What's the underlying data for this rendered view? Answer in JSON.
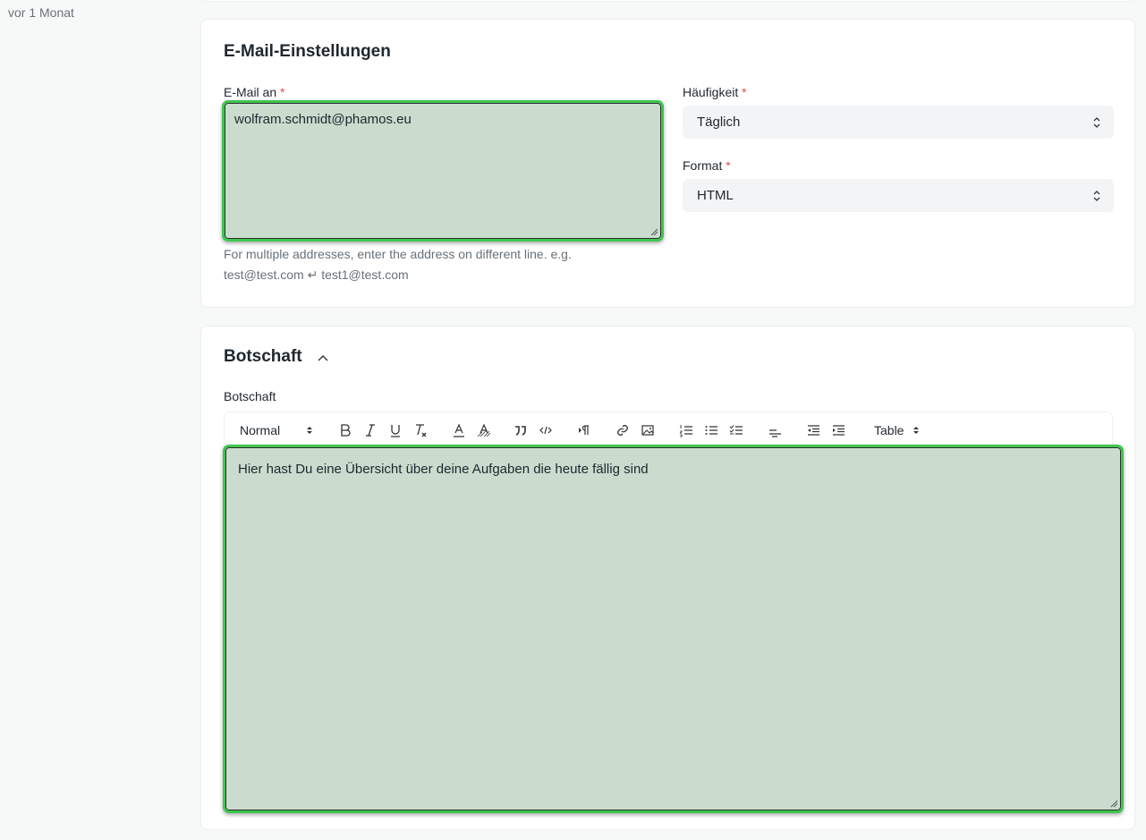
{
  "sidebar": {
    "timestamp": "vor 1 Monat"
  },
  "email_settings": {
    "title": "E-Mail-Einstellungen",
    "email_to": {
      "label": "E-Mail an",
      "required_mark": "*",
      "value": "wolfram.schmidt@phamos.eu",
      "help_line1": "For multiple addresses, enter the address on different line. e.g.",
      "help_line2": "test@test.com ↵ test1@test.com"
    },
    "frequency": {
      "label": "Häufigkeit",
      "required_mark": "*",
      "value": "Täglich"
    },
    "format": {
      "label": "Format",
      "required_mark": "*",
      "value": "HTML"
    }
  },
  "message": {
    "title": "Botschaft",
    "field_label": "Botschaft",
    "toolbar": {
      "heading_select": "Normal",
      "table_select": "Table",
      "icons": [
        "bold-icon",
        "italic-icon",
        "underline-icon",
        "clear-format-icon",
        "text-color-icon",
        "background-color-icon",
        "blockquote-icon",
        "code-icon",
        "direction-icon",
        "link-icon",
        "image-icon",
        "ordered-list-icon",
        "bullet-list-icon",
        "check-list-icon",
        "align-icon",
        "outdent-icon",
        "indent-icon"
      ]
    },
    "content": "Hier hast Du eine Übersicht über deine Aufgaben die heute fällig sind"
  },
  "colors": {
    "accent_border": "#3ec74f",
    "highlight_fill": "#cadcce",
    "required": "#e24c4c"
  }
}
